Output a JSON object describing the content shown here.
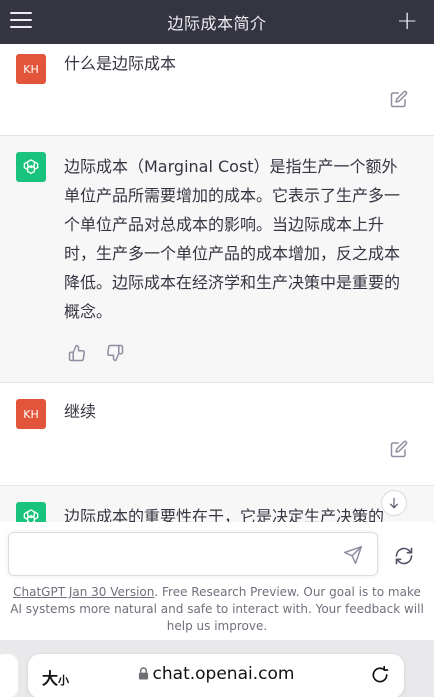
{
  "header": {
    "title": "边际成本简介"
  },
  "messages": [
    {
      "role": "user",
      "avatar": "KH",
      "text": "什么是边际成本"
    },
    {
      "role": "assistant",
      "text": "边际成本（Marginal Cost）是指生产一个额外单位产品所需要增加的成本。它表示了生产多一个单位产品对总成本的影响。当边际成本上升时，生产多一个单位产品的成本增加，反之成本降低。边际成本在经济学和生产决策中是重要的概念。"
    },
    {
      "role": "user",
      "avatar": "KH",
      "text": "继续"
    },
    {
      "role": "assistant",
      "text": "边际成本的重要性在于，它是决定生产决策的"
    }
  ],
  "input": {
    "placeholder": ""
  },
  "footer": {
    "version_link": "ChatGPT Jan 30 Version",
    "note": ". Free Research Preview. Our goal is to make AI systems more natural and safe to interact with. Your feedback will help us improve."
  },
  "browser": {
    "text_size_label": "大",
    "text_size_small": "小",
    "url": "chat.openai.com"
  },
  "colors": {
    "header_bg": "#343541",
    "user_avatar": "#e2553a",
    "assistant_avatar": "#19c37d",
    "assistant_bg": "#f7f7f8"
  }
}
